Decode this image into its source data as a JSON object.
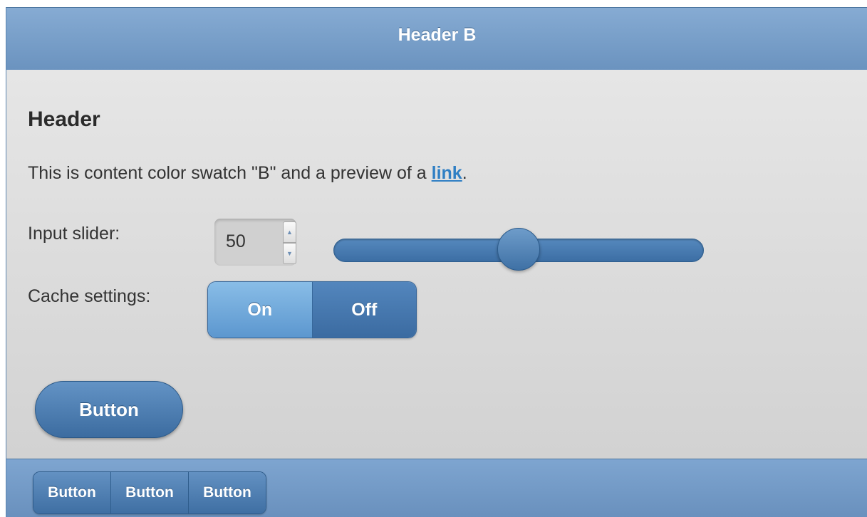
{
  "header": {
    "title": "Header B"
  },
  "content": {
    "heading": "Header",
    "text_before_link": "This is content color swatch \"B\" and a preview of a ",
    "link_text": "link",
    "text_after_link": "."
  },
  "slider": {
    "label": "Input slider:",
    "value": "50",
    "level": 0.5,
    "spin_up_icon": "spin-up-arrow",
    "spin_down_icon": "spin-down-arrow"
  },
  "cache": {
    "label": "Cache settings:",
    "on_label": "On",
    "off_label": "Off"
  },
  "button": {
    "label": "Button"
  },
  "footer": {
    "buttons": [
      "Button",
      "Button",
      "Button"
    ]
  },
  "colors": {
    "bar": "#779fca",
    "accent_blue": "#4a7cb1",
    "link": "#2f7fc4",
    "content_bg": "#dcdcdc"
  }
}
